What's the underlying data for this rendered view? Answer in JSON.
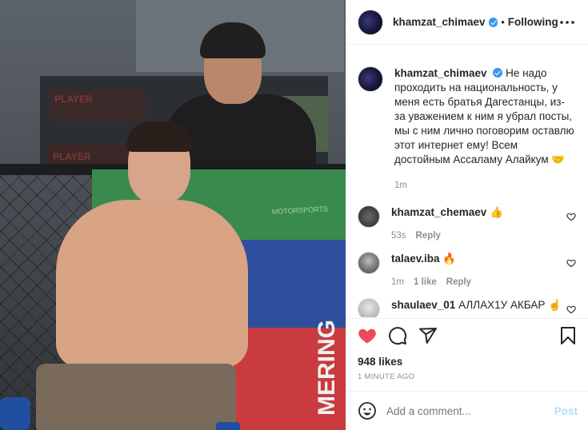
{
  "post": {
    "author": "khamzat_chimaev",
    "follow_status": "Following",
    "more_icon": "more-horizontal-icon",
    "caption": "Не надо проходить на национальность, у меня есть братья Дагестанцы, из-за уважением к ним я убрал посты, мы с ним лично поговорим оставлю этот интернет ему! Всем достойным Ассаламу Алайкум 🤝",
    "caption_age": "1m",
    "photo_texts": [
      "PLAYER",
      "PLAYER",
      "MOTORSPORTS",
      "MERING"
    ]
  },
  "comments": [
    {
      "user": "khamzat_chemaev",
      "text": "👍",
      "age": "53s",
      "likes": "",
      "reply": "Reply"
    },
    {
      "user": "talaev.iba",
      "text": "🔥",
      "age": "1m",
      "likes": "1 like",
      "reply": "Reply"
    },
    {
      "user": "shaulaev_01",
      "text": "АЛЛАХ1У АКБАР ☝",
      "age": "",
      "likes": "",
      "reply": ""
    }
  ],
  "actions": {
    "like_icon": "heart-icon",
    "like_color": "#ed4956",
    "comment_icon": "comment-icon",
    "share_icon": "share-icon",
    "save_icon": "bookmark-icon"
  },
  "stats": {
    "likes": "948 likes",
    "time_ago": "1 MINUTE AGO"
  },
  "add_comment": {
    "placeholder": "Add a comment...",
    "post_label": "Post",
    "emoji_icon": "emoji-icon"
  },
  "colors": {
    "verified": "#3897f0",
    "post_disabled": "#b2dffc",
    "muted": "#8e8e8e"
  }
}
